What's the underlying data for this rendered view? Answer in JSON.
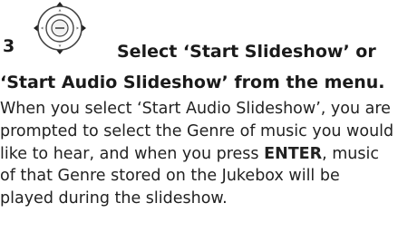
{
  "step": {
    "number": "3",
    "icon": "enter-dpad-icon"
  },
  "heading": {
    "line1": "Select ‘Start Slideshow’ or",
    "line2": "‘Start Audio Slideshow’ from the menu."
  },
  "body": {
    "part1": "When you select ‘Start Audio Slideshow’, you are prompted to select the Genre of music you would like to hear, and when you press ",
    "key": "ENTER",
    "part2": ", music of that Genre stored on the Jukebox will be played during the slideshow."
  },
  "colors": {
    "text": "#1a1a1a",
    "icon_stroke": "#444444"
  }
}
